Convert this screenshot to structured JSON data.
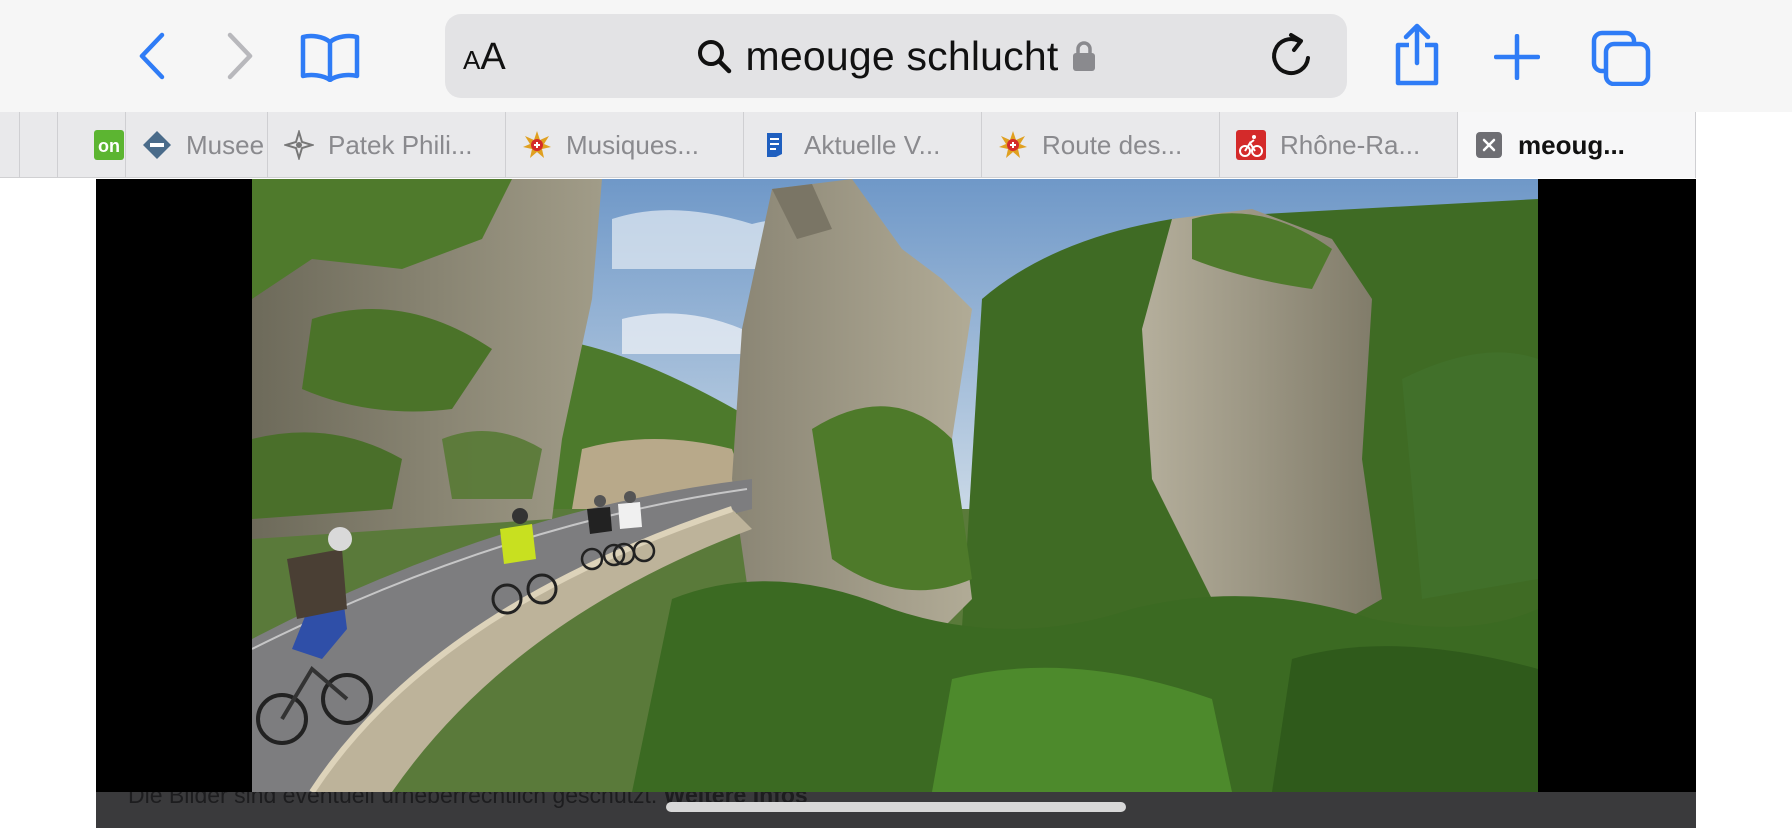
{
  "toolbar": {
    "text_size_small": "A",
    "text_size_large": "A",
    "url": "meouge schlucht"
  },
  "tabs": [
    {
      "label": "",
      "favicon": "green-on-icon",
      "color": "#5cb531"
    },
    {
      "label": "Musee",
      "favicon": "diamond-logo-icon",
      "color": "#4a6b8a"
    },
    {
      "label": "Patek Phili...",
      "favicon": "maltese-cross-icon",
      "color": "#777777"
    },
    {
      "label": "Musiques...",
      "favicon": "swiss-star-icon",
      "color": "#e0a020"
    },
    {
      "label": "Aktuelle V...",
      "favicon": "document-icon",
      "color": "#1f5fbf"
    },
    {
      "label": "Route des...",
      "favicon": "swiss-star-icon",
      "color": "#e0a020"
    },
    {
      "label": "Rhône-Ra...",
      "favicon": "cyclist-icon",
      "color": "#d42a2a"
    },
    {
      "label": "meoug...",
      "favicon": "close-icon",
      "color": "#6e6e73"
    }
  ],
  "content": {
    "caption_text": "Die Bilder sind eventuell urheberrechtlich geschützt. ",
    "caption_link": "Weitere Infos"
  },
  "colors": {
    "accent": "#2f7cf6",
    "toolbar_bg": "#f6f6f6",
    "address_bg": "#e3e3e5"
  }
}
